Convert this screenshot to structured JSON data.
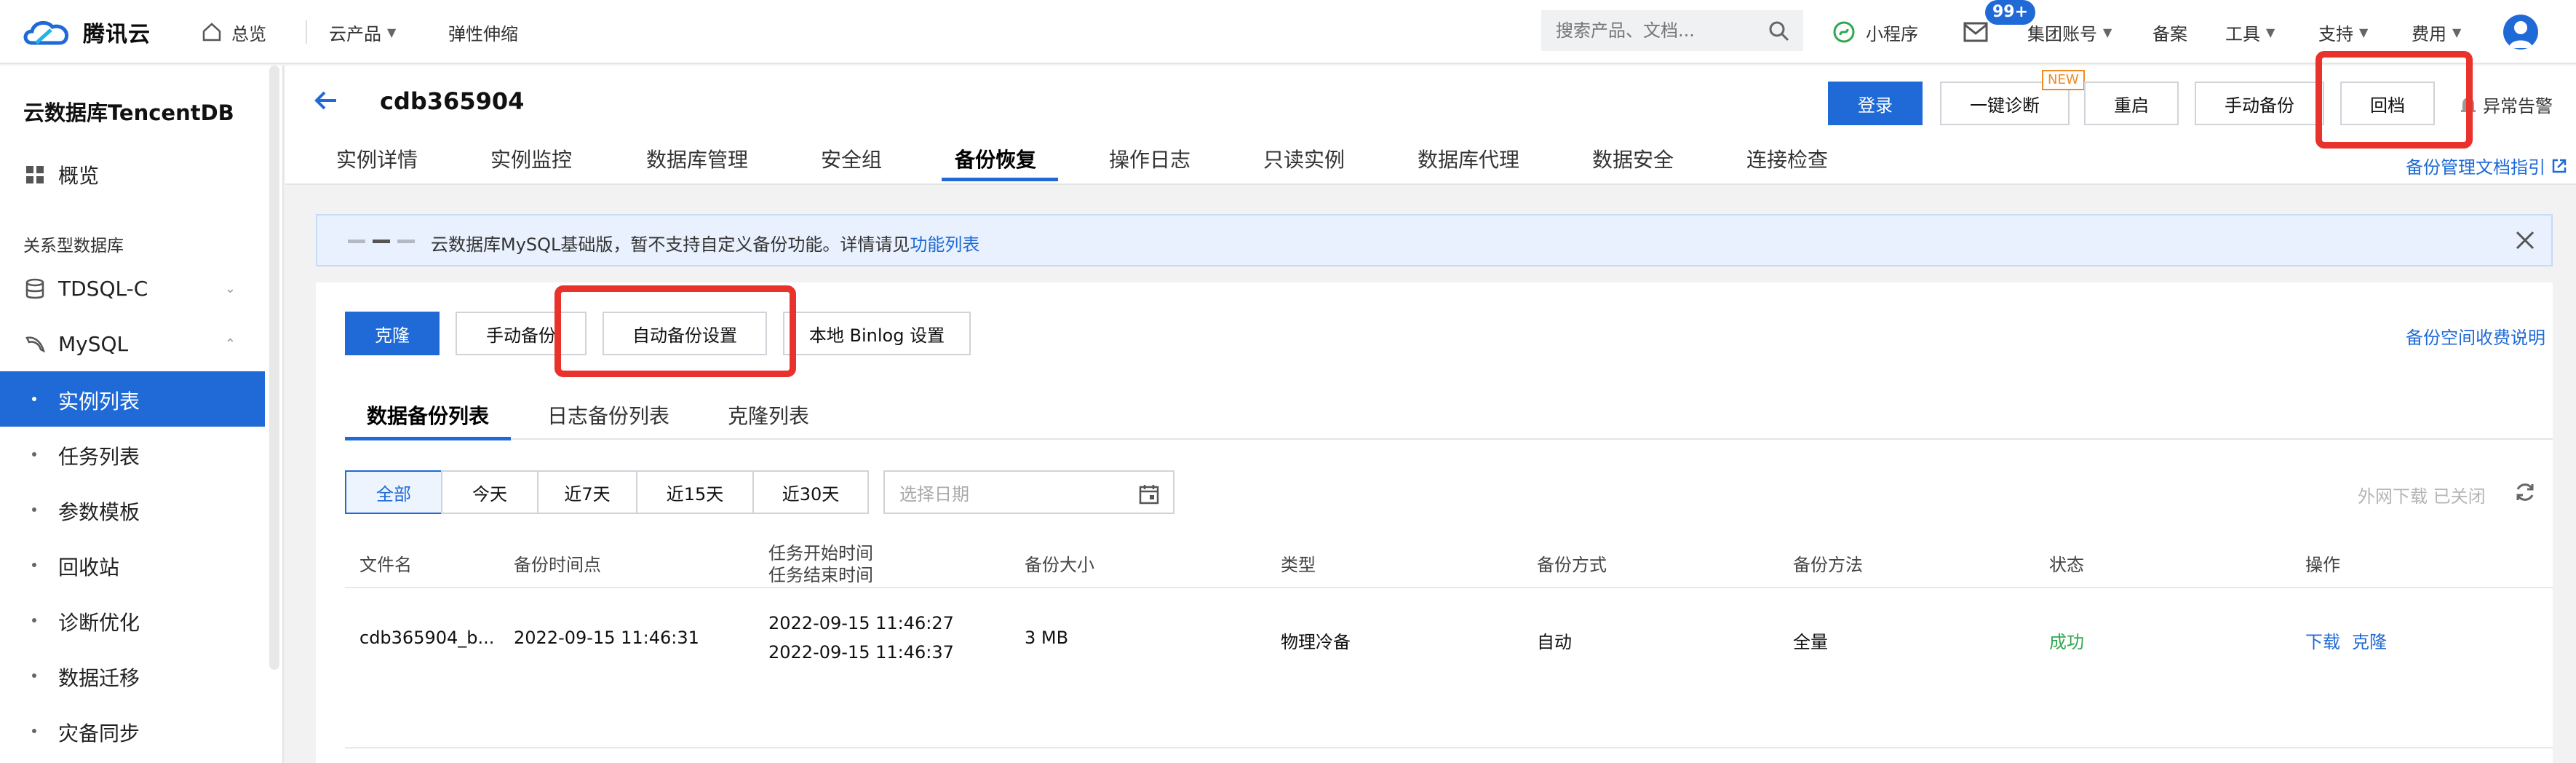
{
  "topbar": {
    "brand": "腾讯云",
    "overview": "总览",
    "products": "云产品",
    "elastic": "弹性伸缩",
    "search_placeholder": "搜索产品、文档...",
    "mini_program": "小程序",
    "message_badge": "99+",
    "group_account": "集团账号",
    "filing": "备案",
    "tools": "工具",
    "support": "支持",
    "billing": "费用"
  },
  "sidebar": {
    "title": "云数据库TencentDB",
    "overview": "概览",
    "section_relational": "关系型数据库",
    "tdsql": "TDSQL-C",
    "mysql": "MySQL",
    "items": [
      "实例列表",
      "任务列表",
      "参数模板",
      "回收站",
      "诊断优化",
      "数据迁移",
      "灾备同步"
    ]
  },
  "header": {
    "instance_name": "cdb365904",
    "buttons": {
      "login": "登录",
      "diagnose": "一键诊断",
      "restart": "重启",
      "manual_backup": "手动备份",
      "rollback": "回档",
      "alert": "异常告警"
    },
    "new_tag": "NEW",
    "tabs": [
      "实例详情",
      "实例监控",
      "数据库管理",
      "安全组",
      "备份恢复",
      "操作日志",
      "只读实例",
      "数据库代理",
      "数据安全",
      "连接检查"
    ],
    "doc_link": "备份管理文档指引"
  },
  "notice": {
    "text": "云数据库MySQL基础版，暂不支持自定义备份功能。详情请见",
    "link": "功能列表"
  },
  "card": {
    "actions": {
      "clone": "克隆",
      "manual_backup": "手动备份",
      "auto_backup": "自动备份设置",
      "binlog": "本地 Binlog 设置"
    },
    "fee_link": "备份空间收费说明",
    "subtabs": [
      "数据备份列表",
      "日志备份列表",
      "克隆列表"
    ],
    "filters": [
      "全部",
      "今天",
      "近7天",
      "近15天",
      "近30天"
    ],
    "date_placeholder": "选择日期",
    "external_download": "外网下载 已关闭"
  },
  "table": {
    "headers": {
      "file": "文件名",
      "backup_time": "备份时间点",
      "task_start": "任务开始时间",
      "task_end": "任务结束时间",
      "size": "备份大小",
      "type": "类型",
      "mode": "备份方式",
      "method": "备份方法",
      "status": "状态",
      "ops": "操作"
    },
    "rows": [
      {
        "file": "cdb365904_b...",
        "backup_time": "2022-09-15 11:46:31",
        "task_start": "2022-09-15 11:46:27",
        "task_end": "2022-09-15 11:46:37",
        "size": "3 MB",
        "type": "物理冷备",
        "mode": "自动",
        "method": "全量",
        "status": "成功",
        "download": "下载",
        "clone": "克隆"
      }
    ]
  },
  "colors": {
    "primary": "#1f6ad6",
    "success": "#2fa84f",
    "highlight": "#e8322b"
  }
}
